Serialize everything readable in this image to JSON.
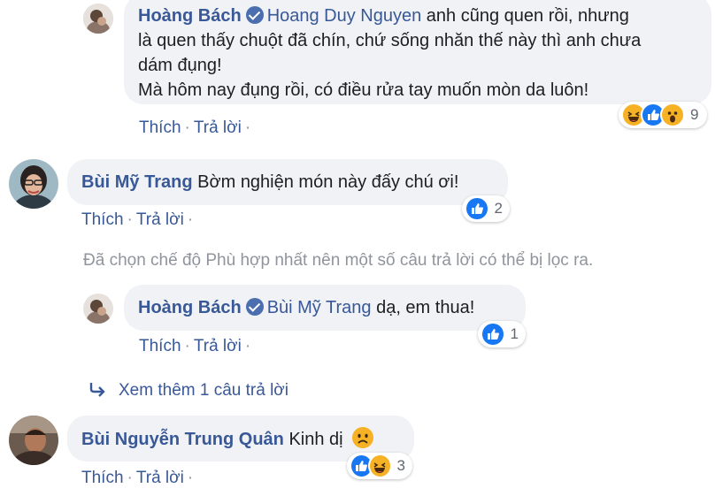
{
  "comments": [
    {
      "author": "Hoàng Bách",
      "mention": "Hoang Duy Nguyen",
      "text_line1": " anh cũng quen rồi, nhưng",
      "text_line2": "là quen thấy chuột đã chín, chứ sống nhăn thế này thì anh chưa",
      "text_line3": "dám đụng!",
      "text_line4": "Mà hôm nay đụng rồi, có điều rửa tay muốn mòn da luôn!",
      "like_label": "Thích",
      "reply_label": "Trả lời",
      "reaction_icons": [
        "haha-icon",
        "like-icon",
        "wow-icon"
      ],
      "reaction_count": "9"
    },
    {
      "author": "Bùi Mỹ Trang",
      "text": "Bờm nghiện món này đấy chú ơi!",
      "like_label": "Thích",
      "reply_label": "Trả lời",
      "reaction_icons": [
        "like-icon"
      ],
      "reaction_count": "2"
    },
    {
      "author": "Hoàng Bách",
      "mention": "Bùi Mỹ Trang",
      "text": " dạ, em thua!",
      "like_label": "Thích",
      "reply_label": "Trả lời",
      "reaction_icons": [
        "like-icon"
      ],
      "reaction_count": "1"
    },
    {
      "author": "Bùi Nguyễn Trung Quân",
      "text": "Kinh dị",
      "emoji_icon": "sad-face-icon",
      "like_label": "Thích",
      "reply_label": "Trả lời",
      "reaction_icons": [
        "like-icon",
        "haha-icon"
      ],
      "reaction_count": "3"
    }
  ],
  "filter_notice": "Đã chọn chế độ Phù hợp nhất nên một số câu trả lời có thể bị lọc ra.",
  "view_more_replies": "Xem thêm 1 câu trả lời",
  "colors": {
    "link": "#385898",
    "bubble": "#f0f2f5",
    "like_blue": "#1877f2",
    "reaction_yellow": "#f7b125",
    "muted": "#90949c"
  }
}
